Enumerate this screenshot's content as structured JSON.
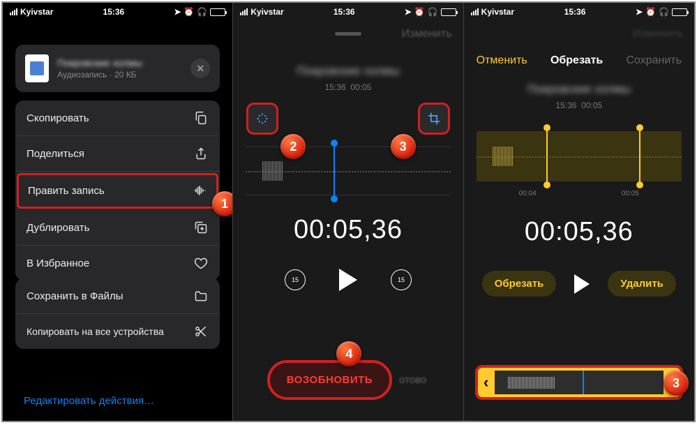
{
  "status": {
    "carrier": "Kyivstar",
    "time": "15:36"
  },
  "screen1": {
    "sheet": {
      "title": "Покровские холмы",
      "subtitle": "Аудиозапись · 20 КБ"
    },
    "menu1": [
      {
        "label": "Скопировать",
        "icon": "copy-icon"
      },
      {
        "label": "Поделиться",
        "icon": "share-icon"
      },
      {
        "label": "Править запись",
        "icon": "waveform-icon",
        "highlight": true
      },
      {
        "label": "Дублировать",
        "icon": "duplicate-icon"
      },
      {
        "label": "В Избранное",
        "icon": "heart-icon"
      }
    ],
    "menu2": [
      {
        "label": "Сохранить в Файлы",
        "icon": "folder-icon"
      },
      {
        "label": "Копировать на все устройства",
        "icon": "scissors-icon"
      }
    ],
    "editActions": "Редактировать действия…"
  },
  "screen2": {
    "headerLink": "Изменить",
    "title": "Покровские холмы",
    "meta_time": "15:36",
    "meta_dur": "00:05",
    "bigTime": "00:05,36",
    "skip": "15",
    "resume": "ВОЗОБНОВИТЬ",
    "done": "отово"
  },
  "screen3": {
    "cancel": "Отменить",
    "title": "Обрезать",
    "save": "Сохранить",
    "recTitle": "Покровские холмы",
    "meta_time": "15:36",
    "meta_dur": "00:05",
    "marks": [
      "00:04",
      "00:05"
    ],
    "bigTime": "00:05,36",
    "trimBtn": "Обрезать",
    "deleteBtn": "Удалить"
  },
  "steps": {
    "s1": "1",
    "s2": "2",
    "s3": "3",
    "s4": "4",
    "s3b": "3"
  }
}
